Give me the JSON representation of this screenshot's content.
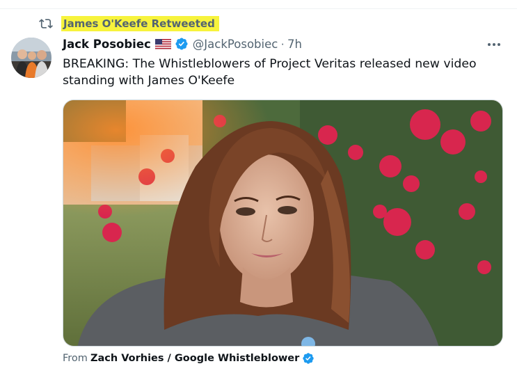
{
  "retweet": {
    "label": "James O'Keefe Retweeted",
    "highlight_color": "#f7f33c"
  },
  "author": {
    "display_name": "Jack Posobiec",
    "handle": "@JackPosobiec",
    "separator": "·",
    "time": "7h",
    "verified_color": "#1d9bf0"
  },
  "tweet": {
    "text": "BREAKING: The Whistleblowers of Project Veritas released new video standing with James O'Keefe"
  },
  "attribution": {
    "from_label": "From",
    "source_name": "Zach Vorhies / Google Whistleblower"
  },
  "icons": {
    "retweet": "retweet-icon",
    "flag": "us-flag-icon",
    "verified": "verified-badge-icon",
    "more": "more-options-icon"
  }
}
